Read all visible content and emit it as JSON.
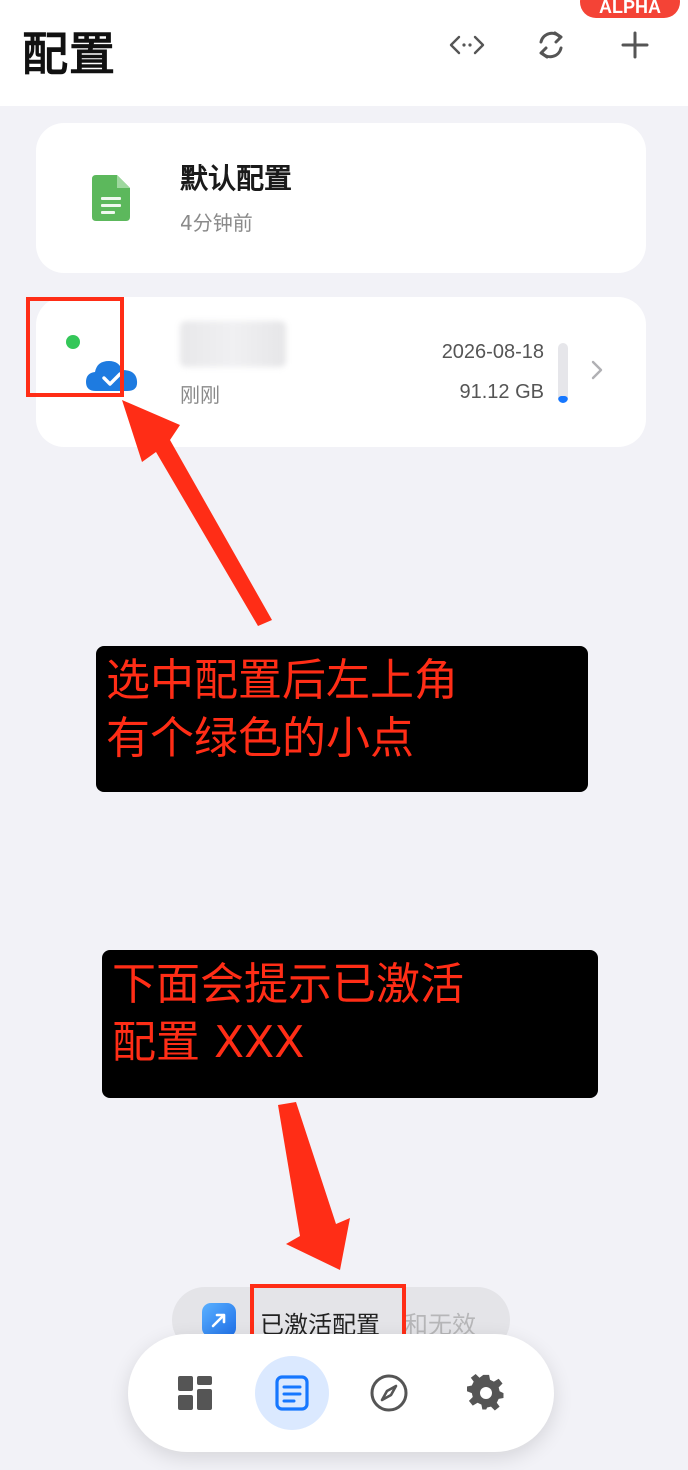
{
  "header": {
    "title": "配置",
    "badge": "ALPHA",
    "icons": [
      "code-icon",
      "sync-icon",
      "add-icon"
    ]
  },
  "profiles": [
    {
      "name": "默认配置",
      "updated": "4分钟前",
      "icon": "document-icon",
      "selected": false
    },
    {
      "name": "",
      "updated": "刚刚",
      "expire_date": "2026-08-18",
      "traffic": "91.12 GB",
      "usage_fraction": 0.12,
      "icon": "cloud-check-icon",
      "selected": true
    }
  ],
  "annotations": {
    "note1": [
      "选中配置后左上角",
      "有个绿色的小点"
    ],
    "note2": [
      "下面会提示已激活",
      "配置 XXX"
    ],
    "color": "#ff2d16"
  },
  "toast": {
    "text": "已激活配置",
    "fading_text": "和无效"
  },
  "tabs": [
    {
      "name": "dashboard-icon",
      "active": false
    },
    {
      "name": "profiles-icon",
      "active": true
    },
    {
      "name": "compass-icon",
      "active": false
    },
    {
      "name": "settings-icon",
      "active": false
    }
  ],
  "colors": {
    "accent": "#1677ff",
    "active_dot": "#34c759",
    "background": "#f2f2f7"
  }
}
